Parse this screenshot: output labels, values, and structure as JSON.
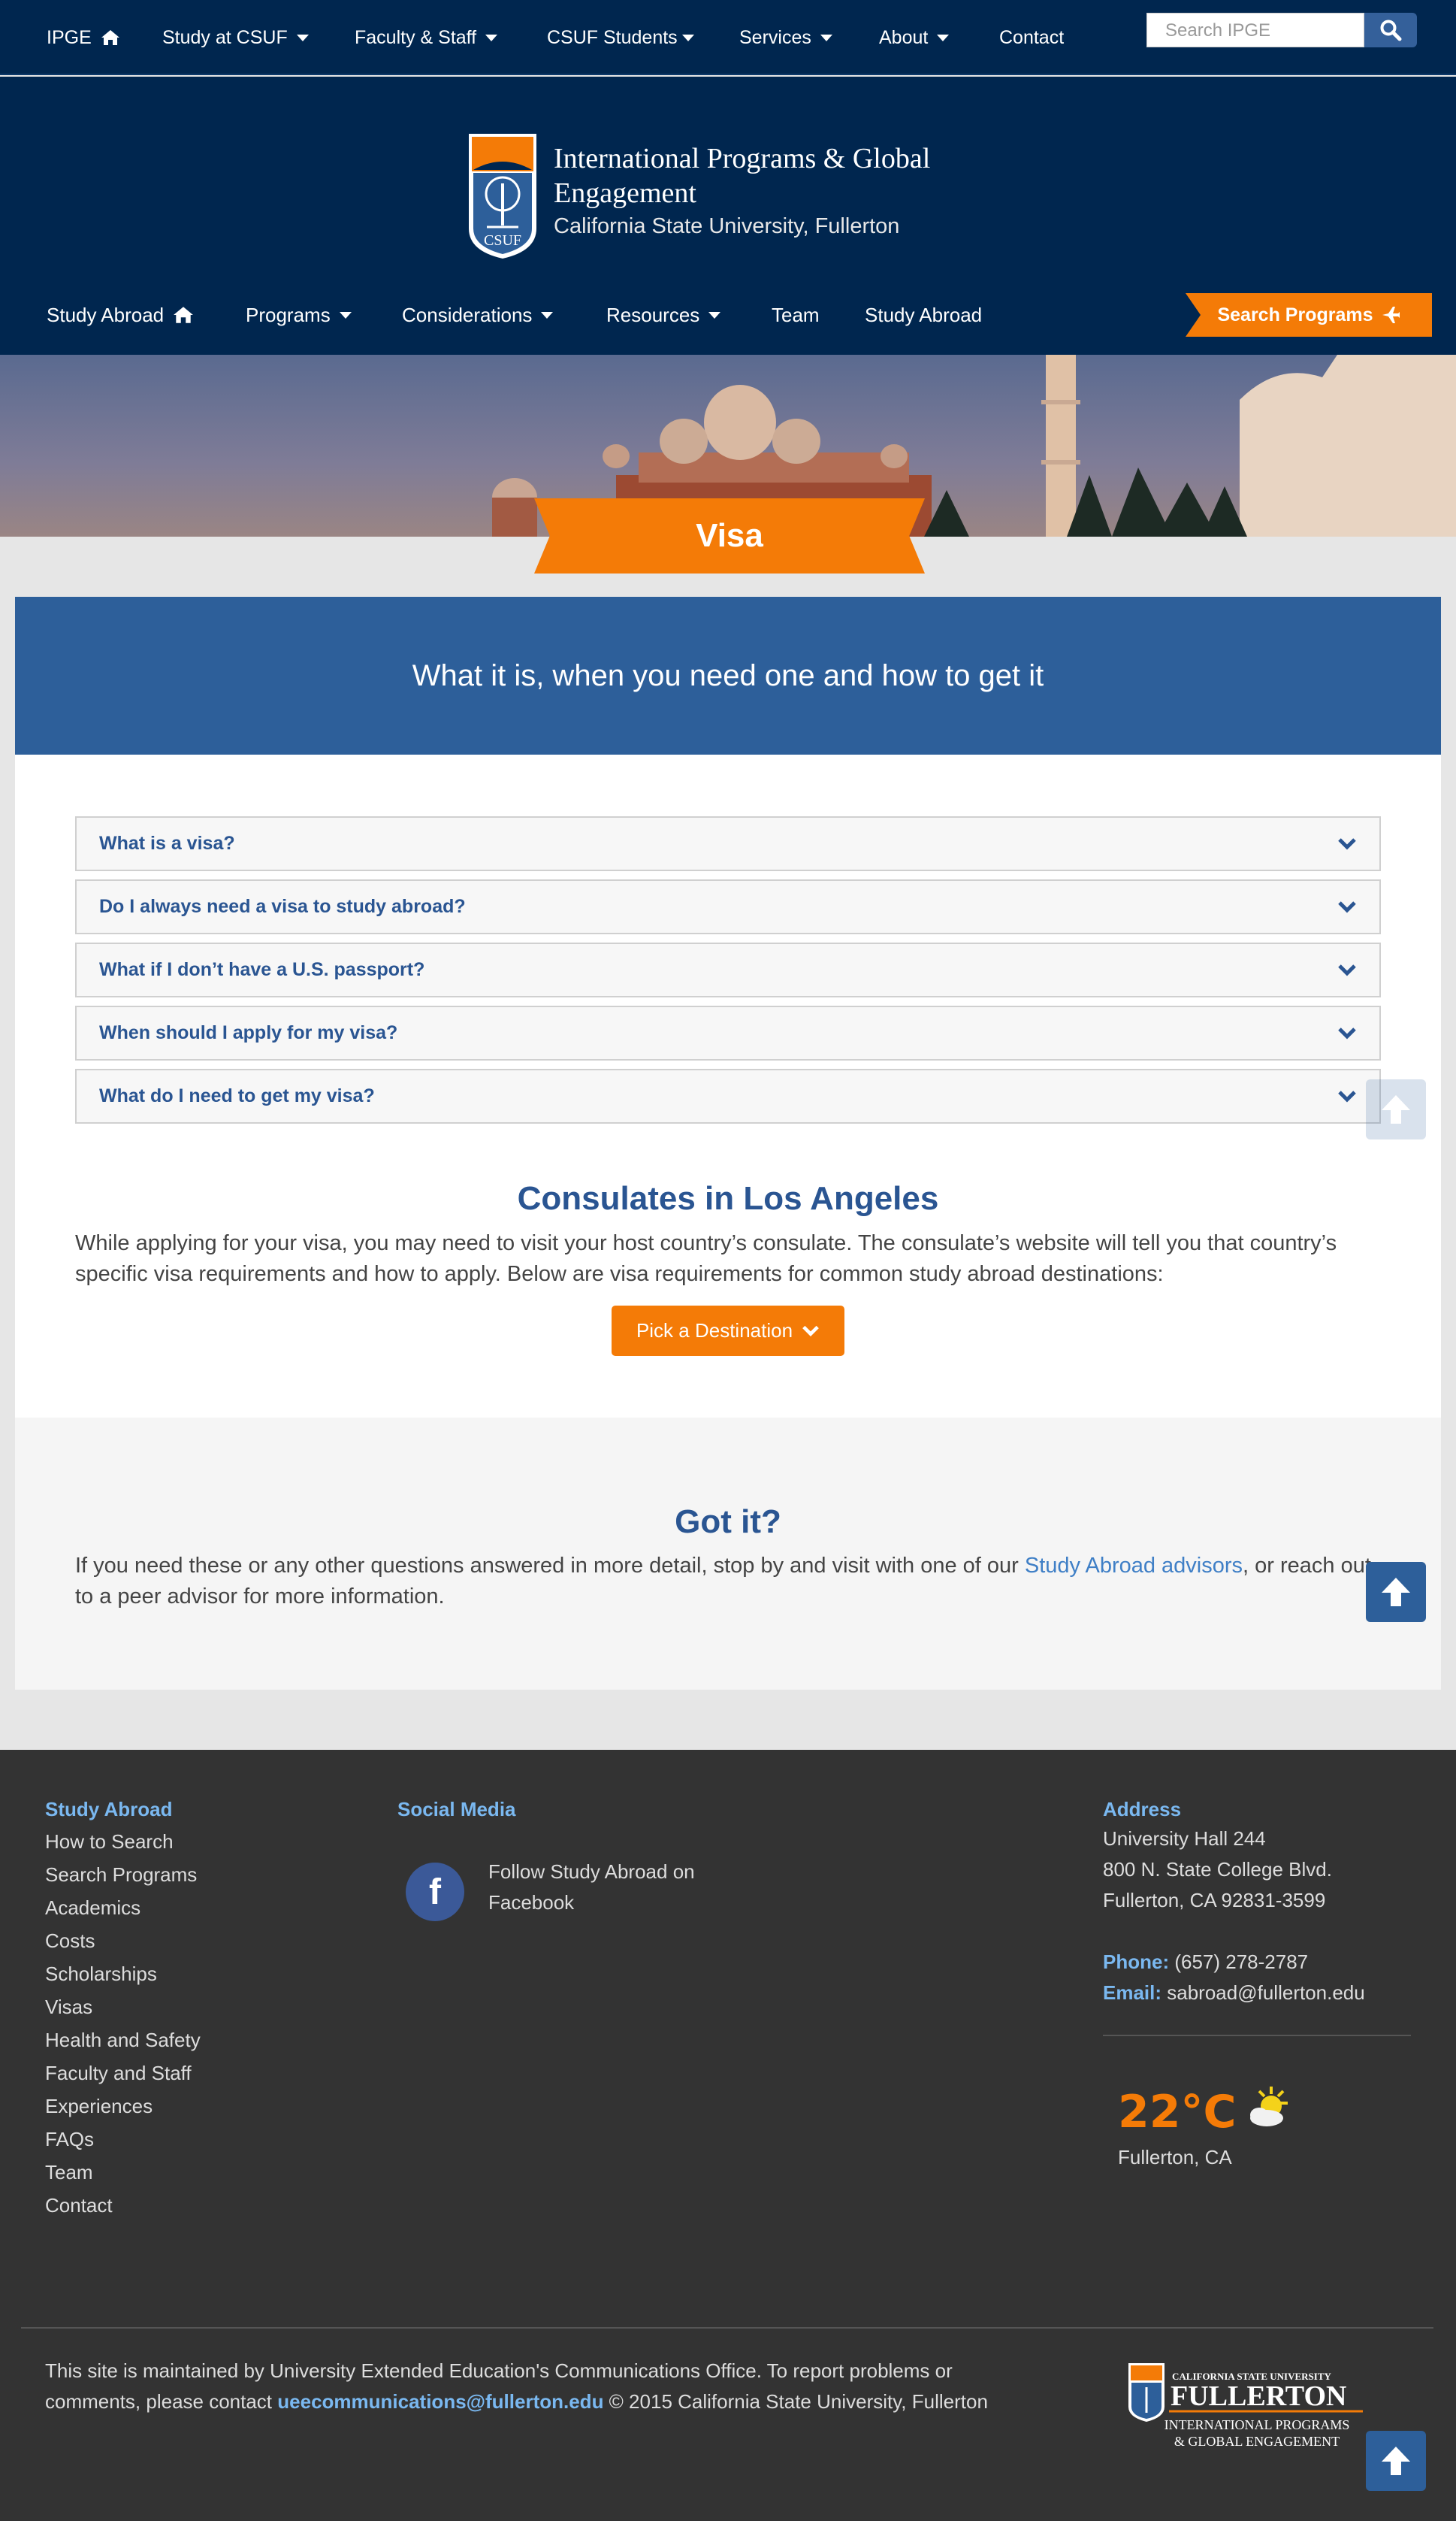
{
  "top_nav": {
    "items": [
      {
        "label": "IPGE",
        "icon": "home-icon"
      },
      {
        "label": "Study at CSUF",
        "icon": "caret-down-icon"
      },
      {
        "label": "Faculty & Staff",
        "icon": "caret-down-icon"
      },
      {
        "label": "CSUF Students",
        "icon": "caret-down-icon"
      },
      {
        "label": "Services",
        "icon": "caret-down-icon"
      },
      {
        "label": "About",
        "icon": "caret-down-icon"
      },
      {
        "label": "Contact"
      }
    ],
    "search_placeholder": "Search IPGE",
    "search_icon": "magnifier-icon"
  },
  "header": {
    "logo_text": "CSUF",
    "title": "International Programs & Global Engagement",
    "subtitle": "California State University, Fullerton"
  },
  "sub_nav": {
    "items": [
      {
        "label": "Study Abroad",
        "icon": "home-icon"
      },
      {
        "label": "Programs",
        "icon": "caret-down-icon"
      },
      {
        "label": "Considerations",
        "icon": "caret-down-icon"
      },
      {
        "label": "Resources",
        "icon": "caret-down-icon"
      },
      {
        "label": "Team"
      },
      {
        "label": "Study Abroad"
      }
    ],
    "search_programs": "Search Programs",
    "search_programs_icon": "plane-icon"
  },
  "page": {
    "banner_title": "Visa",
    "tagline": "What it is, when you need one and how to get it"
  },
  "faq": [
    "What is a visa?",
    "Do I always need a visa to study abroad?",
    "What if I don’t have a U.S. passport?",
    "When should I apply for my visa?",
    "What do I need to get my visa?"
  ],
  "consulates": {
    "title": "Consulates in Los Angeles",
    "text": "While applying for your visa, you may need to visit your host country’s consulate. The consulate’s website will tell you that country’s specific visa requirements and how to apply. Below are visa requirements for common study abroad destinations:",
    "button": "Pick a Destination"
  },
  "got_it": {
    "title": "Got it?",
    "text_before": "If you need these or any other questions answered in more detail, stop by and visit with one of our ",
    "link": "Study Abroad advisors",
    "text_after": ", or reach out to a peer advisor for more information."
  },
  "footer": {
    "study_abroad": {
      "heading": "Study Abroad",
      "links": [
        "How to Search",
        "Search Programs",
        "Academics",
        "Costs",
        "Scholarships",
        "Visas",
        "Health and Safety",
        "Faculty and Staff",
        "Experiences",
        "FAQs",
        "Team",
        "Contact"
      ]
    },
    "social": {
      "heading": "Social Media",
      "facebook_text": "Follow Study Abroad on Facebook"
    },
    "address": {
      "heading": "Address",
      "line1": "University Hall 244",
      "line2": "800 N. State College Blvd.",
      "line3": "Fullerton, CA 92831-3599",
      "phone_label": "Phone:",
      "phone": "(657) 278-2787",
      "email_label": "Email:",
      "email": "sabroad@fullerton.edu"
    },
    "weather": {
      "temp": "22°C",
      "location": "Fullerton, CA",
      "icon": "partly-sunny-icon"
    },
    "copyright_before": "This site is maintained by University Extended Education's Communications Office. To report problems or comments, please contact ",
    "copyright_email": "ueecommunications@fullerton.edu",
    "copyright_after": " © 2015 California State University, Fullerton",
    "logo": {
      "line1": "CALIFORNIA STATE UNIVERSITY",
      "line2": "FULLERTON",
      "line3": "INTERNATIONAL PROGRAMS",
      "line4": "& GLOBAL ENGAGEMENT"
    }
  },
  "colors": {
    "navy": "#00264f",
    "orange": "#f47b07",
    "blue": "#2d5f9a",
    "link": "#7ab8f0"
  }
}
